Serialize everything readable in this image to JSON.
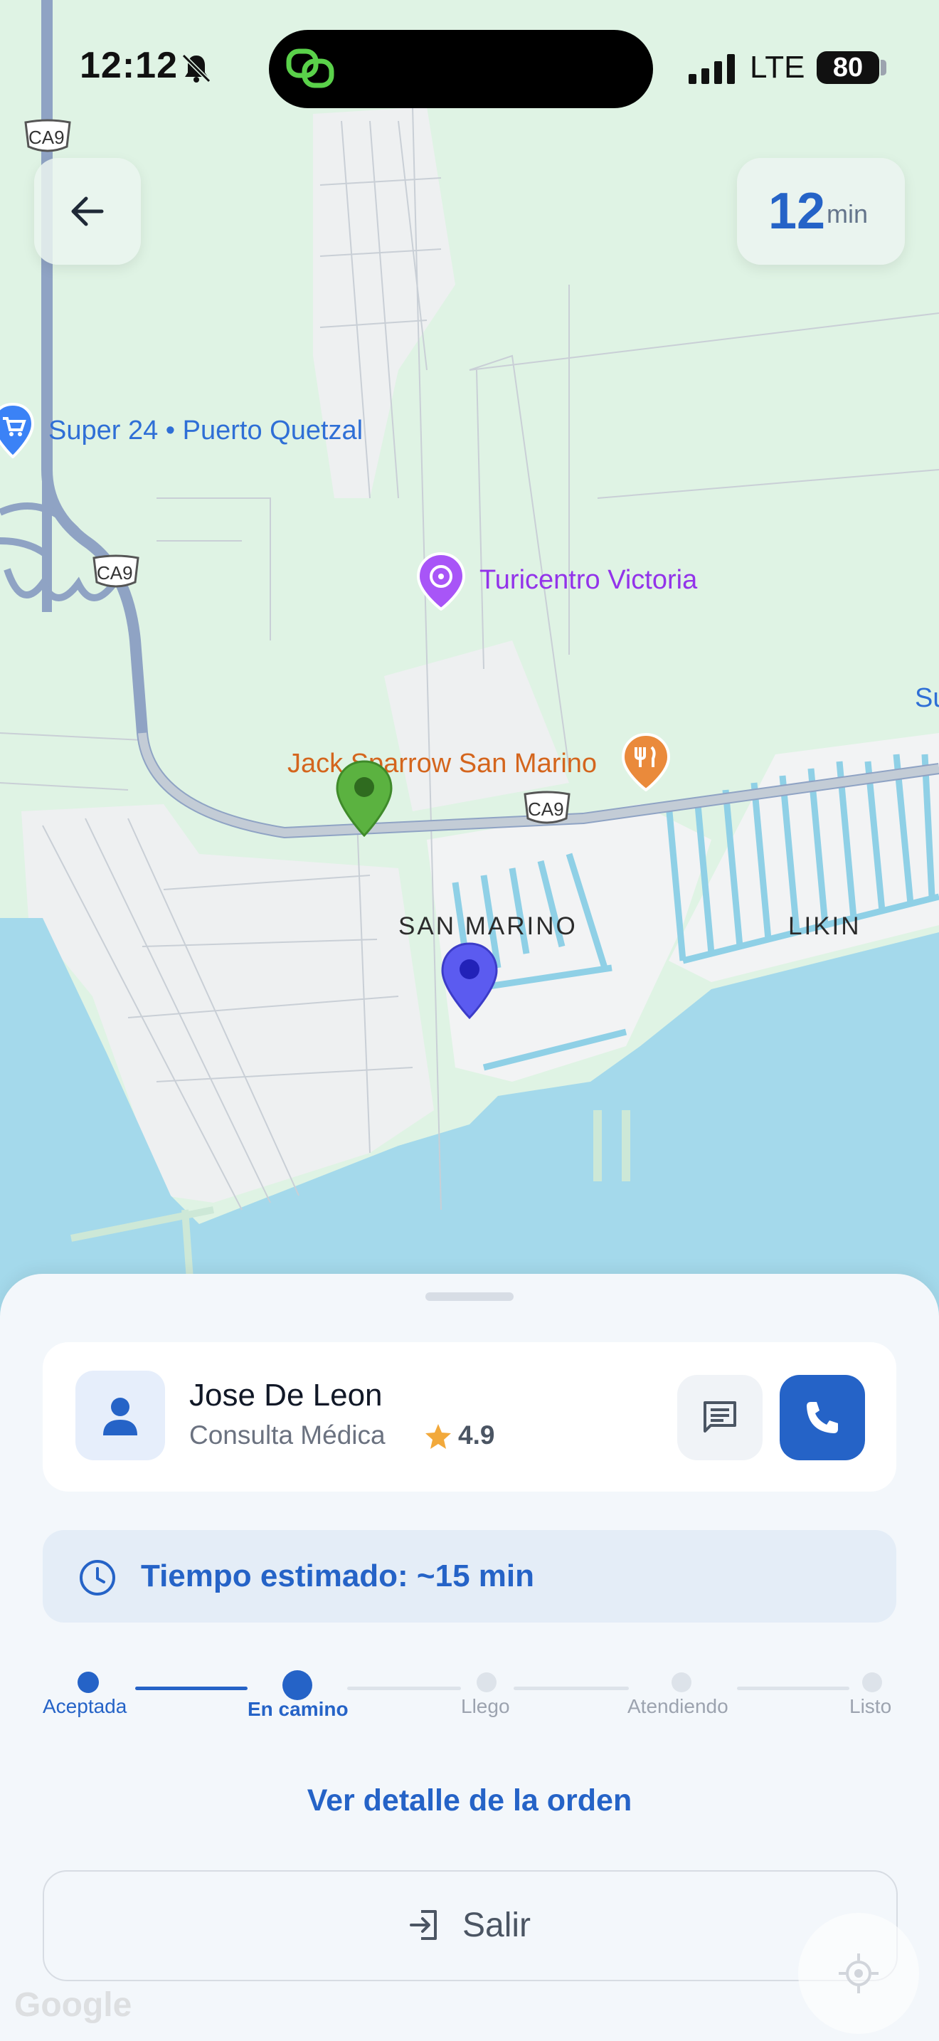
{
  "status_bar": {
    "time": "12:12",
    "network": "LTE",
    "battery": "80"
  },
  "map": {
    "eta_value": "12",
    "eta_unit": "min",
    "route_badges": [
      "CA9",
      "CA9",
      "CA9"
    ],
    "places": {
      "super24": "Super 24 • Puerto Quetzal",
      "turicentro": "Turicentro Victoria",
      "jack": "Jack Sparrow San Marino",
      "san_marino": "SAN MARINO",
      "likin": "LIKIN",
      "partial_su": "Su"
    },
    "colors": {
      "water": "#a4d9eb",
      "land": "#dff3e4",
      "urban": "#f2f3f4",
      "road": "#8fa3c4"
    },
    "icons": [
      "cart-icon",
      "park-icon",
      "fork-knife-icon",
      "driver-pin-icon",
      "destination-pin-icon"
    ]
  },
  "sheet": {
    "person": {
      "name": "Jose De Leon",
      "service": "Consulta Médica",
      "rating": "4.9"
    },
    "estimated_time": "Tiempo estimado: ~15 min",
    "steps": [
      {
        "label": "Aceptada",
        "state": "done"
      },
      {
        "label": "En camino",
        "state": "current"
      },
      {
        "label": "Llego",
        "state": "pending"
      },
      {
        "label": "Atendiendo",
        "state": "pending"
      },
      {
        "label": "Listo",
        "state": "pending"
      }
    ],
    "detail_link": "Ver detalle de la orden",
    "exit_label": "Salir",
    "accent": "#2563c7"
  },
  "watermark": "Google"
}
